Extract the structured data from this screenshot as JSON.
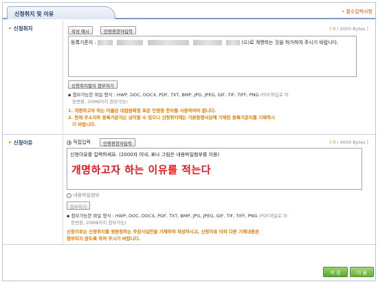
{
  "header": {
    "tab_title": "신청취지 및 이유",
    "required_note": "필수입력사항"
  },
  "purpose": {
    "label": "신청취지",
    "example_button": "작성 예시",
    "hanja_button": "인명용한자입력",
    "counter_current": "0",
    "counter_max": "/ 2000 Bytes",
    "line_prefix": "등록기준지 :",
    "line_suffix": "(으)로 개명하는 것을 허가하여 주시기 바랍니다.",
    "attach_button": "신청취지별지 첨부하기",
    "file_types": "첨부가능한 파일 형식 : HWP, DOC, DOCX, PDF, TXT, BMP, JPG, JPEG, GIF, TIF, TIFF, PNG",
    "file_types_gray": "(PDF파일로 자",
    "file_types_line2": "동변환, 20MB까지 첨부가능)",
    "warn1": "1. 개명하고자 하는 이름은 대법원확정 표준 인명용 한자를 사용하여야 합니다.",
    "warn2a": "2. 현재 주소지와 등록기준지는 상이할 수 있으니 신청취지에는 기본증명서상에 기재된 등록기준지를 기재하시",
    "warn2b": "기 바랍니다."
  },
  "reason": {
    "label": "신청이유",
    "direct_input": "직접입력",
    "hanja_button": "인명용한자입력",
    "counter_current": "0",
    "counter_max": "/ 4000 Bytes",
    "placeholder": "신청이유를 입력하세요. (2000자 이내, 표나 그림은 내용파일첨부를 이용)",
    "big_text": "개명하고자 하는 이유를 적는다",
    "file_attach_radio": "내용파일첨부",
    "attach_button": "첨부하기",
    "file_types": "첨부가능한 파일 형식 : HWP, DOC, DOCX, PDF, TXT, BMP, JPG, JPEG, GIF, TIF, TIFF, PNG",
    "file_types_gray": "(PDF파일로 자",
    "file_types_line2": "동변환, 20MB까지 첨부가능)",
    "warn1": "신청이유는 신청취지를 뒷받침하는 주장사실만을 기재하여 작성하시고, 신청이유 이외 다른 기재내용은",
    "warn2": "첨부되지 않도록 하여 주시기 바랍니다."
  },
  "footer": {
    "save_button": "저 장",
    "next_button": "다 음"
  },
  "colors": {
    "accent": "#1c3c72",
    "warning": "#e07a00",
    "highlight": "#e0181c",
    "button_green": "#5aa62c"
  }
}
